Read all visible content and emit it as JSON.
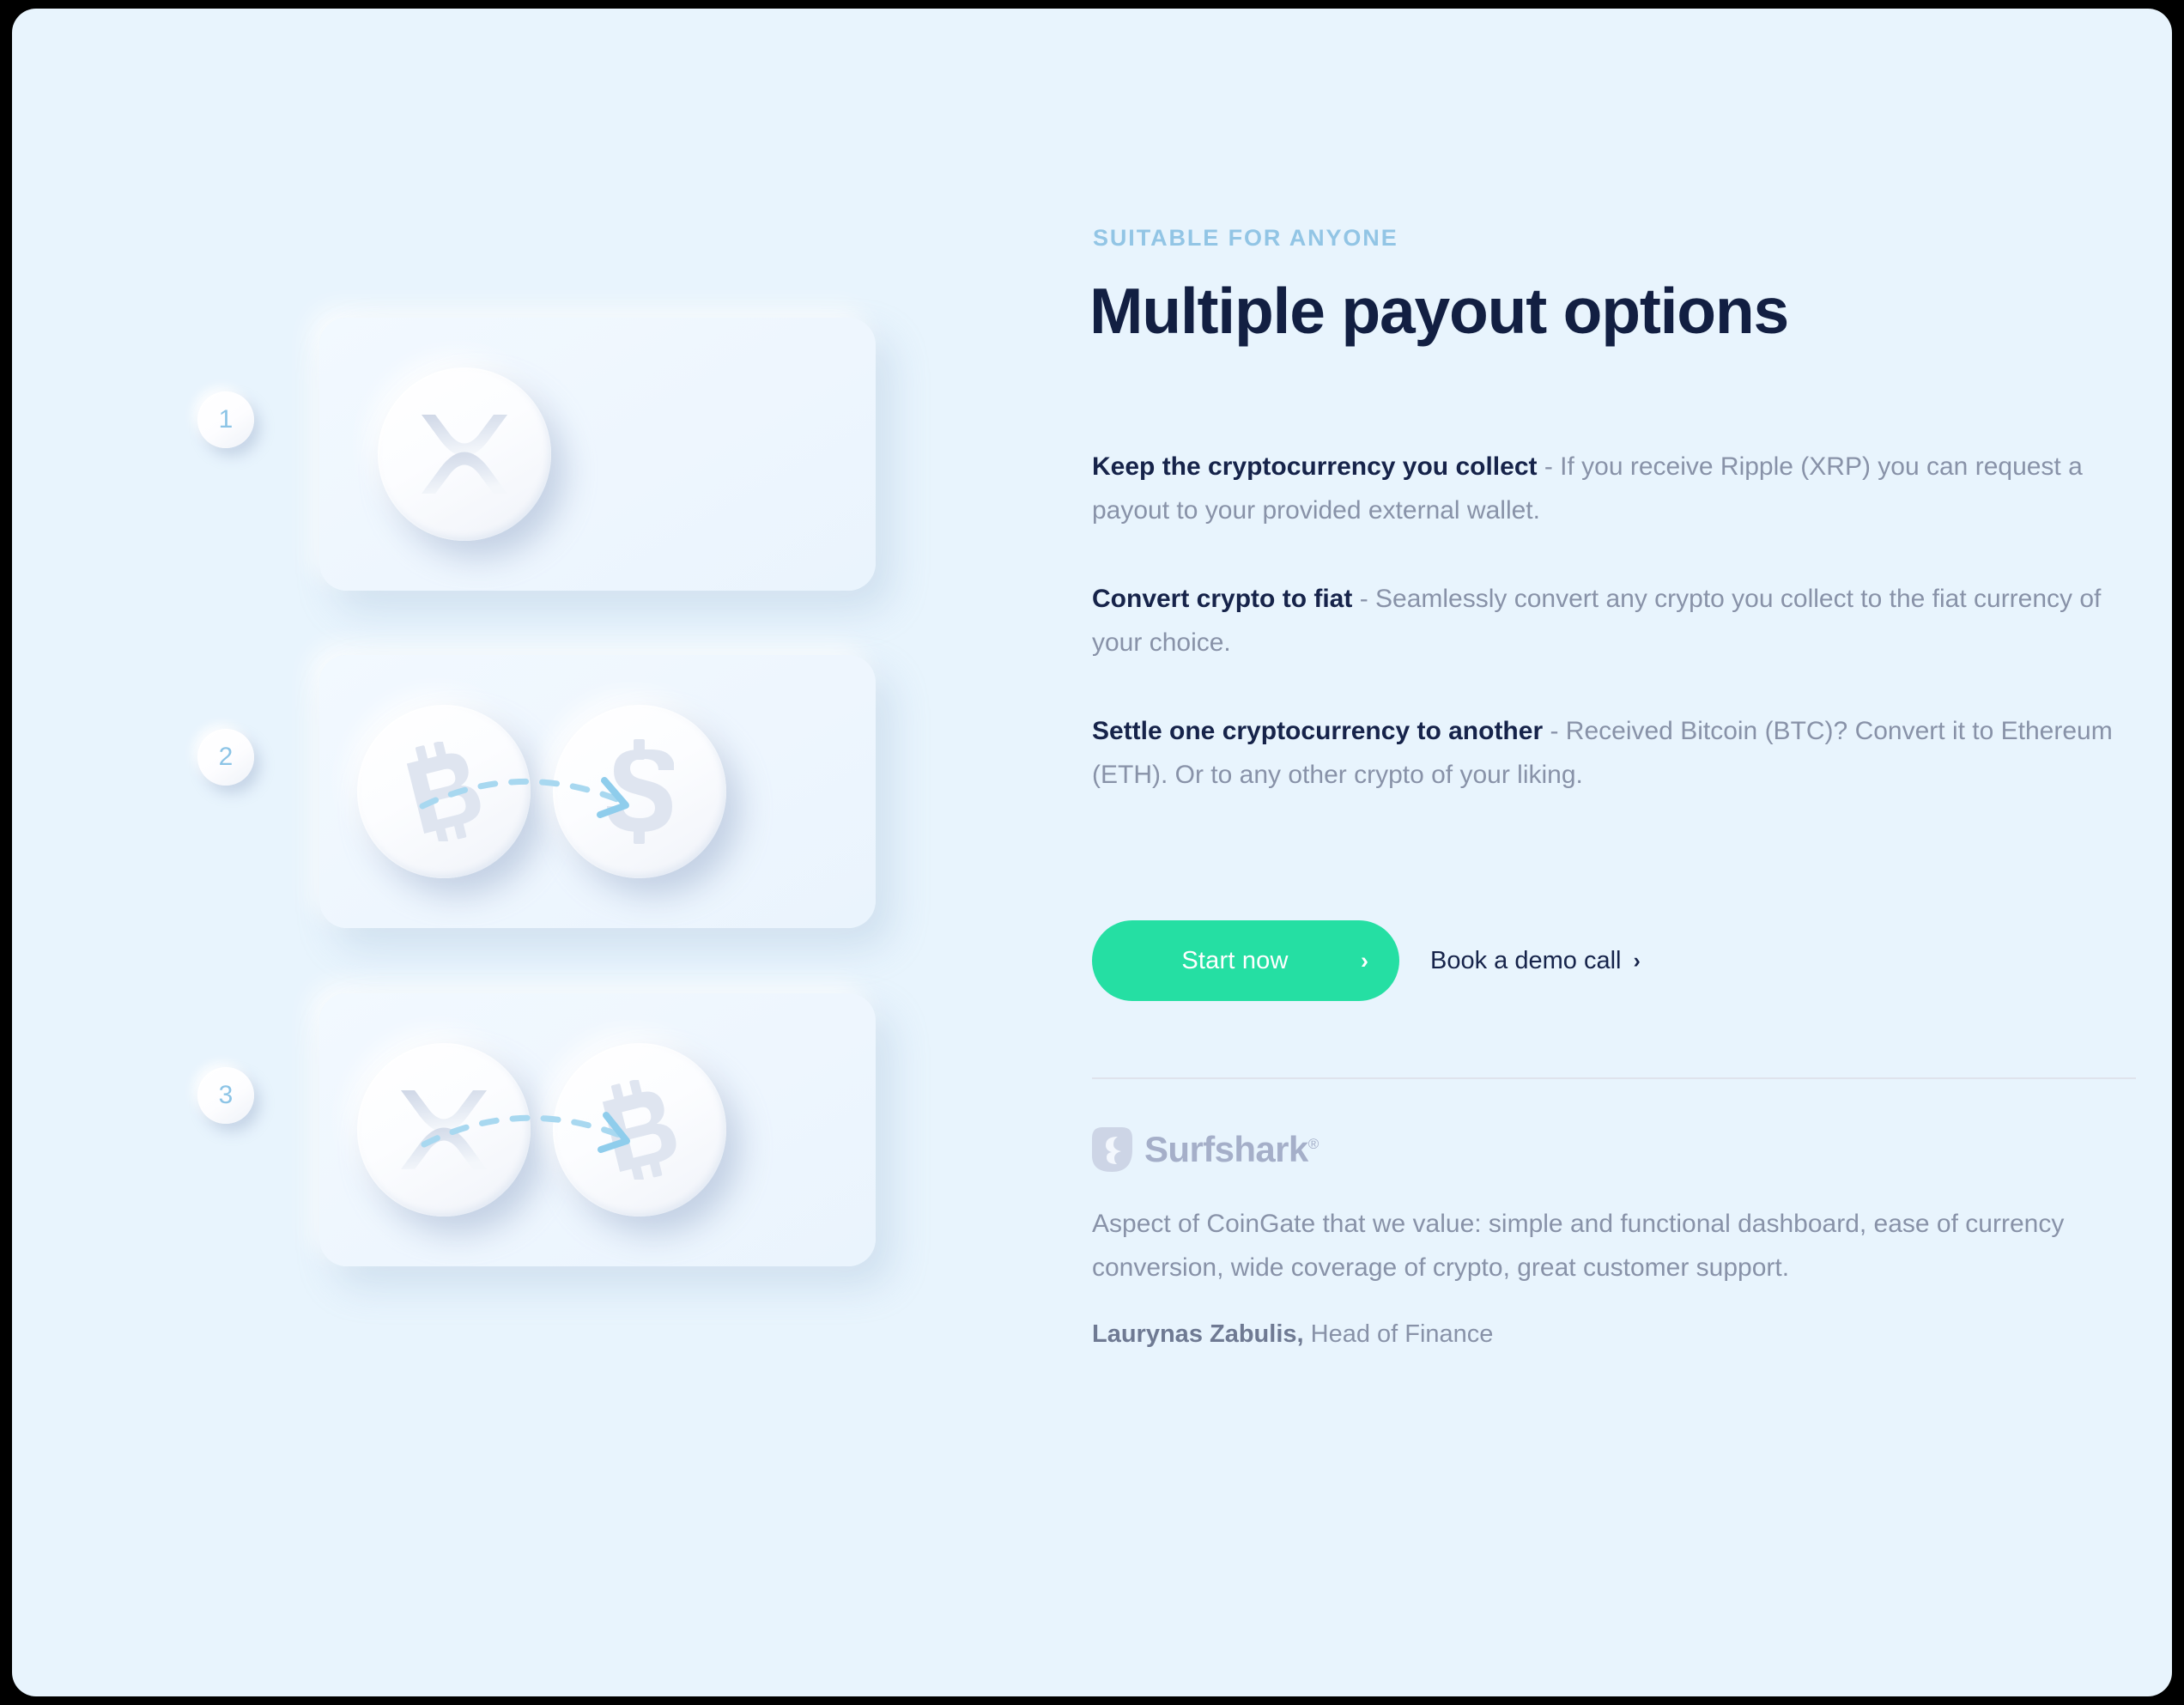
{
  "section": {
    "eyebrow": "SUITABLE FOR ANYONE",
    "title": "Multiple payout options"
  },
  "features": [
    {
      "lead": "Keep the cryptocurrency you collect",
      "body": " - If you receive Ripple (XRP) you can request a payout to your provided external wallet."
    },
    {
      "lead": "Convert crypto to fiat",
      "body": " - Seamlessly convert any crypto you collect to the fiat currency of your choice."
    },
    {
      "lead": "Settle one cryptocurrency to another",
      "body": " - Received Bitcoin (BTC)? Convert it to Ethereum (ETH). Or to any other crypto of your liking."
    }
  ],
  "cta": {
    "primary_label": "Start now",
    "primary_chevron": "›",
    "secondary_label": "Book a demo call",
    "secondary_chevron": "›",
    "primary_color": "#25dfa3"
  },
  "testimonial": {
    "logo_name": "Surfshark",
    "logo_registered": "®",
    "quote": "Aspect of CoinGate that we value: simple and functional dashboard, ease of currency conversion, wide coverage of crypto, great customer support.",
    "author": "Laurynas Zabulis,",
    "role": " Head of Finance"
  },
  "steps": [
    {
      "number": "1",
      "coins": [
        "xrp"
      ],
      "arrow": false
    },
    {
      "number": "2",
      "coins": [
        "btc",
        "usd"
      ],
      "arrow": true
    },
    {
      "number": "3",
      "coins": [
        "xrp",
        "btc"
      ],
      "arrow": true
    }
  ],
  "colors": {
    "page_background": "#e8f4fd",
    "panel_background": "#eff7fe",
    "title": "#121f42",
    "body_text": "#8892a8",
    "eyebrow": "#92c5e5",
    "badge_number": "#8cc4e6",
    "accent_green": "#25dfa3",
    "arrow": "#a8d8f0",
    "coin_glyph": "#dde3ee",
    "logo": "#a5afc9"
  }
}
